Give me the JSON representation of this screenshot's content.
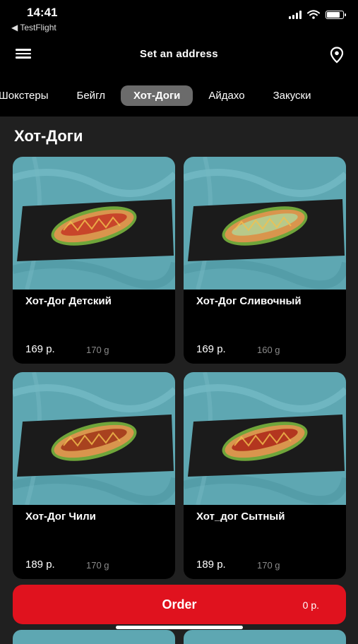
{
  "status_bar": {
    "time": "14:41",
    "back_app": "◀ TestFlight",
    "battery_level": 0.75
  },
  "header": {
    "address": "Set an address",
    "menu_icon": "hamburger-menu-icon",
    "location_icon": "location-pin-icon"
  },
  "tabs": [
    {
      "label": "Шокстеры"
    },
    {
      "label": "Бейгл"
    },
    {
      "label": "Хот-Доги",
      "active": true
    },
    {
      "label": "Айдахо"
    },
    {
      "label": "Закуски"
    }
  ],
  "section": {
    "title": "Хот-Доги"
  },
  "products": [
    {
      "name": "Хот-Дог Детский",
      "price": "169 р.",
      "weight": "170 g",
      "topping": "#c8452a"
    },
    {
      "name": "Хот-Дог Сливочный",
      "price": "169 р.",
      "weight": "160 g",
      "topping": "#b8c98a"
    },
    {
      "name": "Хот-Дог Чили",
      "price": "189 р.",
      "weight": "170 g",
      "topping": "#a8421f"
    },
    {
      "name": "Хот_дог Сытный",
      "price": "189 р.",
      "weight": "170 g",
      "topping": "#b3361f"
    }
  ],
  "order": {
    "label": "Order",
    "total": "0 р."
  },
  "colors": {
    "accent": "#e0121e",
    "background": "#202020",
    "card": "#000000",
    "tab_active": "#6b6b6b",
    "photo_backdrop": "#5ea7b2",
    "slate": "#1b1b1b",
    "bun": "#d9954d",
    "lettuce": "#6fa53a"
  }
}
